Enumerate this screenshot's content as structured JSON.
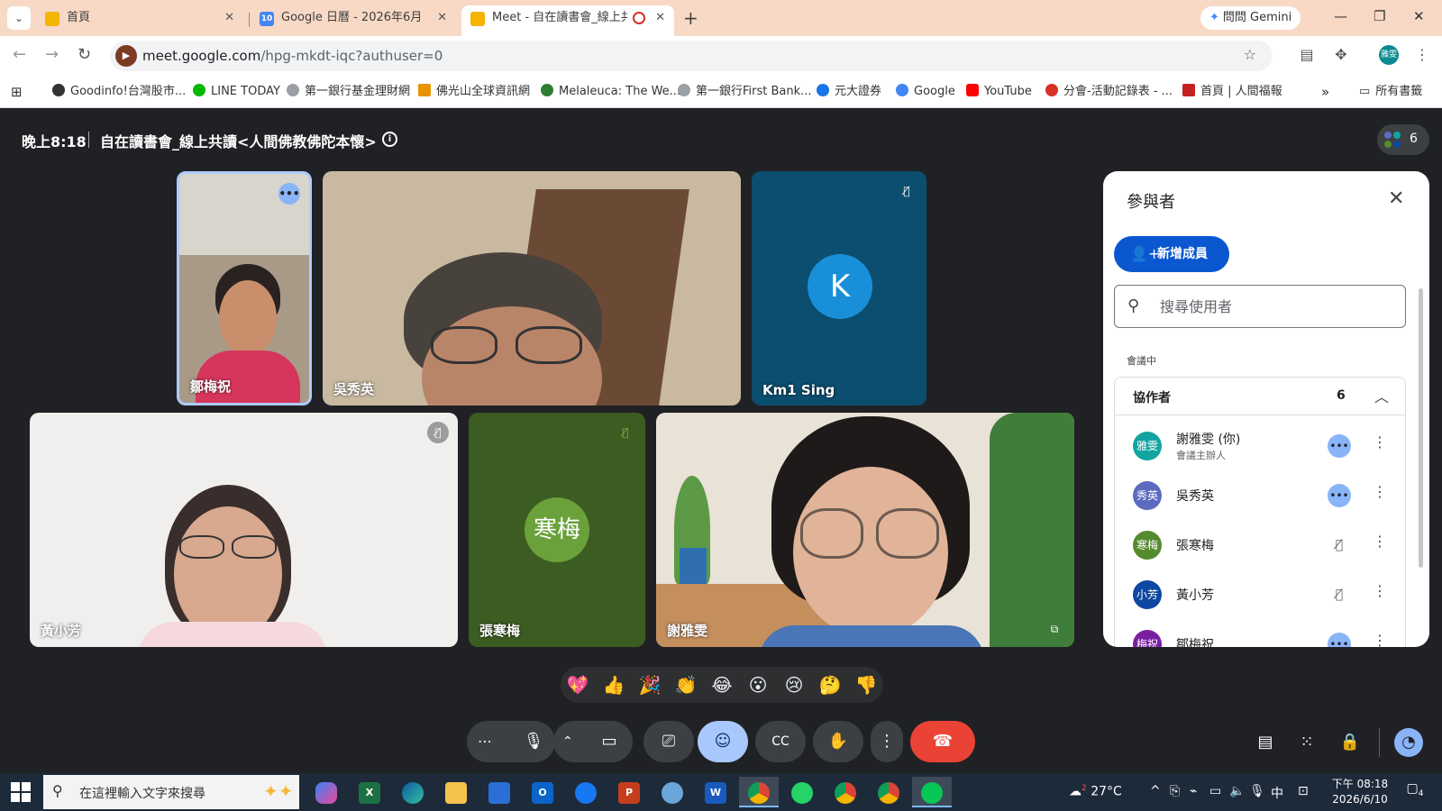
{
  "browser": {
    "tabs": [
      {
        "label": "首頁",
        "icon": "notes-tab-icon",
        "color": "#f4b400",
        "active": false
      },
      {
        "label": "Google 日曆 - 2026年6月",
        "icon": "calendar-tab-icon",
        "color": "#4285f4",
        "icon_text": "10",
        "active": false
      },
      {
        "label": "Meet - 自在讀書會_線上共",
        "icon": "meet-tab-icon",
        "color": "#f4b400",
        "active": true
      }
    ],
    "gemini_label": "問問 Gemini",
    "url_host": "meet.google.com",
    "url_path": "/hpg-mkdt-iqc?authuser=0",
    "bookmarks": [
      {
        "label": "Goodinfo!台灣股市...",
        "color": "#333333"
      },
      {
        "label": "LINE TODAY",
        "color": "#00b900"
      },
      {
        "label": "第一銀行基金理財網",
        "color": "#9aa0a6"
      },
      {
        "label": "佛光山全球資訊網",
        "color": "#e69500"
      },
      {
        "label": "Melaleuca: The We...",
        "color": "#2e7d32"
      },
      {
        "label": "第一銀行First Bank...",
        "color": "#9aa0a6"
      },
      {
        "label": "元大證券",
        "color": "#1a73e8"
      },
      {
        "label": "Google",
        "color": "#4285f4"
      },
      {
        "label": "YouTube",
        "color": "#ff0000"
      },
      {
        "label": "分會-活動記錄表 - ...",
        "color": "#d93025"
      },
      {
        "label": "首頁 | 人間福報",
        "color": "#c5221f"
      }
    ],
    "all_bookmarks": "所有書籤"
  },
  "meet": {
    "time": "晚上8:18",
    "title": "自在讀書會_線上共讀<人間佛教佛陀本懷>",
    "participant_count": "6",
    "tiles": [
      {
        "name": "鄒梅祝",
        "type": "video"
      },
      {
        "name": "吳秀英",
        "type": "video"
      },
      {
        "name": "Km1 Sing",
        "type": "avatar",
        "initial": "K",
        "muted": true
      },
      {
        "name": "黃小芳",
        "type": "video",
        "muted": true
      },
      {
        "name": "張寒梅",
        "type": "avatar",
        "initial": "寒梅",
        "muted": true
      },
      {
        "name": "謝雅雯",
        "type": "video"
      }
    ],
    "reactions": [
      "💖",
      "👍",
      "🎉",
      "👏",
      "😂",
      "😮",
      "😢",
      "🤔",
      "👎"
    ],
    "panel": {
      "title": "參與者",
      "add_label": "新增成員",
      "search_placeholder": "搜尋使用者",
      "section": "會議中",
      "group_label": "協作者",
      "group_count": "6",
      "people": [
        {
          "name": "謝雅雯 (你)",
          "role": "會議主辦人",
          "avatar": "雅雯",
          "color": "#12a4a0",
          "status": "dots"
        },
        {
          "name": "吳秀英",
          "role": "",
          "avatar": "秀英",
          "color": "#5c6bc0",
          "status": "dots"
        },
        {
          "name": "張寒梅",
          "role": "",
          "avatar": "寒梅",
          "color": "#558b2f",
          "status": "muted"
        },
        {
          "name": "黃小芳",
          "role": "",
          "avatar": "小芳",
          "color": "#0d47a1",
          "status": "muted"
        },
        {
          "name": "鄒梅祝",
          "role": "",
          "avatar": "梅祝",
          "color": "#7b1fa2",
          "status": "dots"
        }
      ]
    }
  },
  "taskbar": {
    "search_placeholder": "在這裡輸入文字來搜尋",
    "weather": "27°C",
    "ime": "中",
    "time": "下午 08:18",
    "date": "2026/6/10",
    "notification_count": "4",
    "weather_badge": "2"
  }
}
